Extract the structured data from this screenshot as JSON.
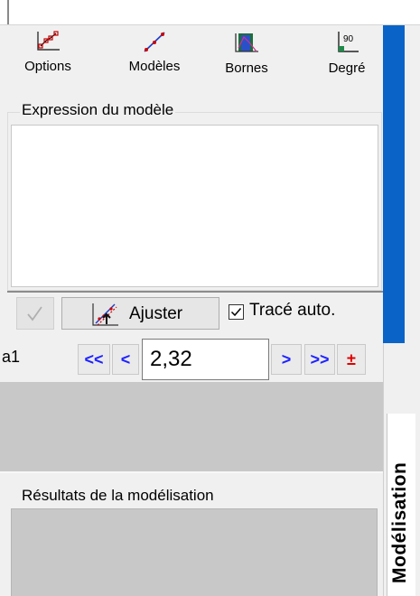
{
  "toolbar": {
    "options_label": "Options",
    "modeles_label": "Modèles",
    "bornes_label": "Bornes",
    "degre_label": "Degré",
    "degre_icon_text": "90"
  },
  "expression": {
    "caption": "Expression du modèle",
    "value": ""
  },
  "controls": {
    "ajuster_label": "Ajuster",
    "trace_auto_label": "Tracé auto.",
    "trace_auto_checked": true
  },
  "parameter": {
    "name": "a1",
    "fast_back": "<<",
    "back": "<",
    "value": "2,32",
    "forward": ">",
    "fast_forward": ">>",
    "plus_minus": "±"
  },
  "results": {
    "caption": "Résultats de la modélisation"
  },
  "side_tab": {
    "label": "Modélisation"
  },
  "colors": {
    "accent": "#0a64c8",
    "arrow_blue": "#1e22ff",
    "pm_red": "#e00000"
  }
}
